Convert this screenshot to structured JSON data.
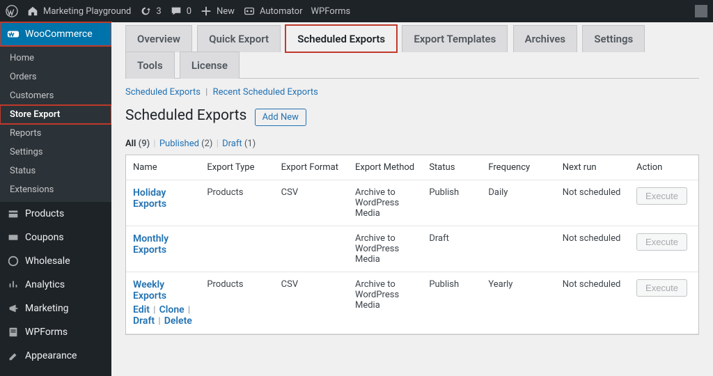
{
  "adminbar": {
    "site_name": "Marketing Playground",
    "updates": "3",
    "comments": "0",
    "new": "New",
    "automator": "Automator",
    "wpforms": "WPForms"
  },
  "sidebar": {
    "top": {
      "label": "WooCommerce"
    },
    "submenu": [
      {
        "label": "Home"
      },
      {
        "label": "Orders"
      },
      {
        "label": "Customers"
      },
      {
        "label": "Store Export",
        "current": true
      },
      {
        "label": "Reports"
      },
      {
        "label": "Settings"
      },
      {
        "label": "Status"
      },
      {
        "label": "Extensions"
      }
    ],
    "after": [
      {
        "label": "Products",
        "icon": "products"
      },
      {
        "label": "Coupons",
        "icon": "coupons"
      },
      {
        "label": "Wholesale",
        "icon": "wholesale"
      },
      {
        "label": "Analytics",
        "icon": "analytics"
      },
      {
        "label": "Marketing",
        "icon": "marketing"
      },
      {
        "label": "WPForms",
        "icon": "wpforms"
      },
      {
        "label": "Appearance",
        "icon": "appearance"
      }
    ]
  },
  "tabs": [
    {
      "label": "Overview"
    },
    {
      "label": "Quick Export"
    },
    {
      "label": "Scheduled Exports",
      "active": true
    },
    {
      "label": "Export Templates"
    },
    {
      "label": "Archives"
    },
    {
      "label": "Settings"
    },
    {
      "label": "Tools"
    },
    {
      "label": "License"
    }
  ],
  "sublinks": {
    "a": "Scheduled Exports",
    "b": "Recent Scheduled Exports"
  },
  "page": {
    "title": "Scheduled Exports",
    "add_new": "Add New"
  },
  "views": {
    "all_label": "All",
    "all_count": "(9)",
    "published_label": "Published",
    "published_count": "(2)",
    "draft_label": "Draft",
    "draft_count": "(1)"
  },
  "table": {
    "columns": {
      "name": "Name",
      "type": "Export Type",
      "format": "Export Format",
      "method": "Export Method",
      "status": "Status",
      "frequency": "Frequency",
      "next_run": "Next run",
      "action": "Action"
    },
    "rows": [
      {
        "name": "Holiday Exports",
        "type": "Products",
        "format": "CSV",
        "method": "Archive to WordPress Media",
        "status": "Publish",
        "frequency": "Daily",
        "next_run": "Not scheduled",
        "action": "Execute"
      },
      {
        "name": "Monthly Exports",
        "type": "",
        "format": "",
        "method": "Archive to WordPress Media",
        "status": "Draft",
        "frequency": "",
        "next_run": "Not scheduled",
        "action": "Execute"
      },
      {
        "name": "Weekly Exports",
        "type": "Products",
        "format": "CSV",
        "method": "Archive to WordPress Media",
        "status": "Publish",
        "frequency": "Yearly",
        "next_run": "Not scheduled",
        "action": "Execute",
        "row_actions": {
          "edit": "Edit",
          "clone": "Clone",
          "draft": "Draft",
          "delete": "Delete"
        }
      }
    ]
  }
}
